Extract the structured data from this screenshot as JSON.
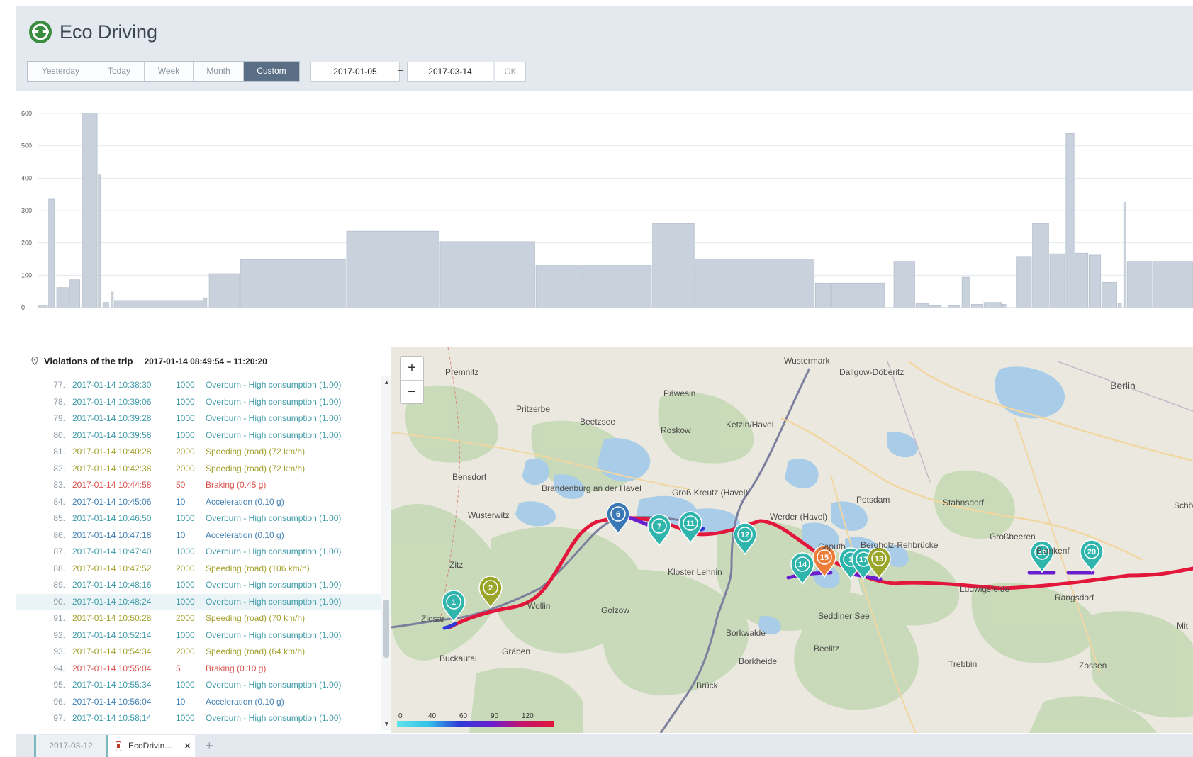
{
  "header": {
    "title": "Eco Driving",
    "periods": [
      "Yesterday",
      "Today",
      "Week",
      "Month",
      "Custom"
    ],
    "active_period": "Custom",
    "date_from": "2017-01-05",
    "date_separator": "–",
    "date_to": "2017-03-14",
    "ok_label": "OK"
  },
  "chart_data": {
    "type": "bar",
    "ylim": [
      0,
      600
    ],
    "yticks": [
      "0",
      "100",
      "200",
      "300",
      "400",
      "500",
      "600"
    ],
    "bars": [
      {
        "x0": 0.0,
        "x1": 0.8,
        "value": 8
      },
      {
        "x0": 0.9,
        "x1": 1.4,
        "value": 335
      },
      {
        "x0": 1.6,
        "x1": 2.6,
        "value": 62
      },
      {
        "x0": 2.7,
        "x1": 3.6,
        "value": 86
      },
      {
        "x0": 3.8,
        "x1": 5.1,
        "value": 601
      },
      {
        "x0": 5.2,
        "x1": 5.4,
        "value": 410
      },
      {
        "x0": 5.6,
        "x1": 6.1,
        "value": 16
      },
      {
        "x0": 6.3,
        "x1": 6.5,
        "value": 48
      },
      {
        "x0": 6.6,
        "x1": 14.2,
        "value": 22
      },
      {
        "x0": 14.3,
        "x1": 14.6,
        "value": 30
      },
      {
        "x0": 14.8,
        "x1": 17.4,
        "value": 105
      },
      {
        "x0": 17.5,
        "x1": 26.6,
        "value": 148
      },
      {
        "x0": 26.7,
        "x1": 34.7,
        "value": 236
      },
      {
        "x0": 34.8,
        "x1": 43.0,
        "value": 204
      },
      {
        "x0": 43.1,
        "x1": 47.1,
        "value": 130
      },
      {
        "x0": 47.2,
        "x1": 53.1,
        "value": 130
      },
      {
        "x0": 53.2,
        "x1": 56.8,
        "value": 260
      },
      {
        "x0": 56.9,
        "x1": 67.2,
        "value": 150
      },
      {
        "x0": 67.3,
        "x1": 68.6,
        "value": 76
      },
      {
        "x0": 68.7,
        "x1": 73.3,
        "value": 76
      },
      {
        "x0": 74.1,
        "x1": 75.9,
        "value": 143
      },
      {
        "x0": 76.0,
        "x1": 77.1,
        "value": 12
      },
      {
        "x0": 77.2,
        "x1": 78.2,
        "value": 6
      },
      {
        "x0": 78.8,
        "x1": 79.8,
        "value": 6
      },
      {
        "x0": 80.0,
        "x1": 80.7,
        "value": 94
      },
      {
        "x0": 80.8,
        "x1": 81.8,
        "value": 10
      },
      {
        "x0": 81.9,
        "x1": 83.4,
        "value": 16
      },
      {
        "x0": 83.5,
        "x1": 83.8,
        "value": 10
      },
      {
        "x0": 84.7,
        "x1": 86.0,
        "value": 158
      },
      {
        "x0": 86.1,
        "x1": 87.5,
        "value": 260
      },
      {
        "x0": 87.6,
        "x1": 88.9,
        "value": 166
      },
      {
        "x0": 89.0,
        "x1": 89.7,
        "value": 538
      },
      {
        "x0": 89.8,
        "x1": 90.9,
        "value": 168
      },
      {
        "x0": 91.0,
        "x1": 92.0,
        "value": 162
      },
      {
        "x0": 92.1,
        "x1": 93.4,
        "value": 78
      },
      {
        "x0": 93.5,
        "x1": 93.8,
        "value": 12
      },
      {
        "x0": 94.0,
        "x1": 94.2,
        "value": 325
      },
      {
        "x0": 94.3,
        "x1": 96.4,
        "value": 143
      },
      {
        "x0": 96.5,
        "x1": 100.0,
        "value": 143
      }
    ]
  },
  "violations": {
    "title": "Violations of the trip",
    "trip_range": "2017-01-14 08:49:54 – 11:20:20",
    "rows": [
      {
        "num": "77.",
        "time": "2017-01-14 10:38:30",
        "value": "1000",
        "desc": "Overburn - High consumption (1.00)",
        "kind": "overburn"
      },
      {
        "num": "78.",
        "time": "2017-01-14 10:39:06",
        "value": "1000",
        "desc": "Overburn - High consumption (1.00)",
        "kind": "overburn"
      },
      {
        "num": "79.",
        "time": "2017-01-14 10:39:28",
        "value": "1000",
        "desc": "Overburn - High consumption (1.00)",
        "kind": "overburn"
      },
      {
        "num": "80.",
        "time": "2017-01-14 10:39:58",
        "value": "1000",
        "desc": "Overburn - High consumption (1.00)",
        "kind": "overburn"
      },
      {
        "num": "81.",
        "time": "2017-01-14 10:40:28",
        "value": "2000",
        "desc": "Speeding (road) (72 km/h)",
        "kind": "speeding"
      },
      {
        "num": "82.",
        "time": "2017-01-14 10:42:38",
        "value": "2000",
        "desc": "Speeding (road) (72 km/h)",
        "kind": "speeding"
      },
      {
        "num": "83.",
        "time": "2017-01-14 10:44:58",
        "value": "50",
        "desc": "Braking (0.45 g)",
        "kind": "braking"
      },
      {
        "num": "84.",
        "time": "2017-01-14 10:45:06",
        "value": "10",
        "desc": "Acceleration (0.10 g)",
        "kind": "accel"
      },
      {
        "num": "85.",
        "time": "2017-01-14 10:46:50",
        "value": "1000",
        "desc": "Overburn - High consumption (1.00)",
        "kind": "overburn"
      },
      {
        "num": "86.",
        "time": "2017-01-14 10:47:18",
        "value": "10",
        "desc": "Acceleration (0.10 g)",
        "kind": "accel"
      },
      {
        "num": "87.",
        "time": "2017-01-14 10:47:40",
        "value": "1000",
        "desc": "Overburn - High consumption (1.00)",
        "kind": "overburn"
      },
      {
        "num": "88.",
        "time": "2017-01-14 10:47:52",
        "value": "2000",
        "desc": "Speeding (road) (106 km/h)",
        "kind": "speeding"
      },
      {
        "num": "89.",
        "time": "2017-01-14 10:48:16",
        "value": "1000",
        "desc": "Overburn - High consumption (1.00)",
        "kind": "overburn"
      },
      {
        "num": "90.",
        "time": "2017-01-14 10:48:24",
        "value": "1000",
        "desc": "Overburn - High consumption (1.00)",
        "kind": "overburn",
        "selected": true
      },
      {
        "num": "91.",
        "time": "2017-01-14 10:50:28",
        "value": "2000",
        "desc": "Speeding (road) (70 km/h)",
        "kind": "speeding"
      },
      {
        "num": "92.",
        "time": "2017-01-14 10:52:14",
        "value": "1000",
        "desc": "Overburn - High consumption (1.00)",
        "kind": "overburn"
      },
      {
        "num": "93.",
        "time": "2017-01-14 10:54:34",
        "value": "2000",
        "desc": "Speeding (road) (64 km/h)",
        "kind": "speeding"
      },
      {
        "num": "94.",
        "time": "2017-01-14 10:55:04",
        "value": "5",
        "desc": "Braking (0.10 g)",
        "kind": "braking"
      },
      {
        "num": "95.",
        "time": "2017-01-14 10:55:34",
        "value": "1000",
        "desc": "Overburn - High consumption (1.00)",
        "kind": "overburn"
      },
      {
        "num": "96.",
        "time": "2017-01-14 10:56:04",
        "value": "10",
        "desc": "Acceleration (0.10 g)",
        "kind": "accel"
      },
      {
        "num": "97.",
        "time": "2017-01-14 10:58:14",
        "value": "1000",
        "desc": "Overburn - High consumption (1.00)",
        "kind": "overburn"
      }
    ]
  },
  "colors": {
    "overburn": "#3d9aa8",
    "speeding": "#a2a02c",
    "braking": "#d9534f",
    "accel": "#3f7fb4",
    "bar": "#c9d2dc",
    "header_bg": "#e3e9ef",
    "active_tab": "#5a6f86"
  },
  "map": {
    "zoom_in": "+",
    "zoom_out": "−",
    "labels": [
      {
        "text": "Premnitz"
      },
      {
        "text": "Wustermark"
      },
      {
        "text": "Dallgow-Döberitz"
      },
      {
        "text": "Berlin"
      },
      {
        "text": "Pritzerbe"
      },
      {
        "text": "Päwesin"
      },
      {
        "text": "Beetzsee"
      },
      {
        "text": "Roskow"
      },
      {
        "text": "Ketzin/Havel"
      },
      {
        "text": "Bensdorf"
      },
      {
        "text": "Brandenburg an der Havel"
      },
      {
        "text": "Groß Kreutz (Havel)"
      },
      {
        "text": "Potsdam"
      },
      {
        "text": "Stahnsdorf"
      },
      {
        "text": "Wusterwitz"
      },
      {
        "text": "Werder (Havel)"
      },
      {
        "text": "Schöne"
      },
      {
        "text": "Großbeeren"
      },
      {
        "text": "Bergholz-Rehbrücke"
      },
      {
        "text": "Zitz"
      },
      {
        "text": "Kloster Lehnin"
      },
      {
        "text": "Caputh"
      },
      {
        "text": "Ludwigsfelde"
      },
      {
        "text": "Rangsdorf"
      },
      {
        "text": "Ziesar"
      },
      {
        "text": "Wollin"
      },
      {
        "text": "Golzow"
      },
      {
        "text": "Seddiner See"
      },
      {
        "text": "Mit"
      },
      {
        "text": "Borkwalde"
      },
      {
        "text": "Buckautal"
      },
      {
        "text": "Gräben"
      },
      {
        "text": "Beelitz"
      },
      {
        "text": "Borkheide"
      },
      {
        "text": "Trebbin"
      },
      {
        "text": "Zossen"
      },
      {
        "text": "Brück"
      },
      {
        "text": "Blankenf"
      }
    ],
    "speed_legend": [
      "0",
      "40",
      "60",
      "90",
      "120"
    ],
    "markers": [
      {
        "n": "1",
        "color": "#2fb5ac"
      },
      {
        "n": "2",
        "color": "#9aa52a"
      },
      {
        "n": "6",
        "color": "#3a78b5"
      },
      {
        "n": "7",
        "color": "#2fb5ac"
      },
      {
        "n": "11",
        "color": "#2fb5ac"
      },
      {
        "n": "12",
        "color": "#2fb5ac"
      },
      {
        "n": "14",
        "color": "#2fb5ac"
      },
      {
        "n": "15",
        "color": "#ef7d3a"
      },
      {
        "n": "1",
        "color": "#2fb5ac"
      },
      {
        "n": "17",
        "color": "#2fb5ac"
      },
      {
        "n": "13",
        "color": "#9aa52a"
      },
      {
        "n": "19",
        "color": "#2fb5ac"
      },
      {
        "n": "20",
        "color": "#2fb5ac"
      }
    ]
  },
  "tabs": {
    "date_tab": "2017-03-12",
    "eco_tab": "EcoDrivin...",
    "close": "✕",
    "add": "+"
  }
}
